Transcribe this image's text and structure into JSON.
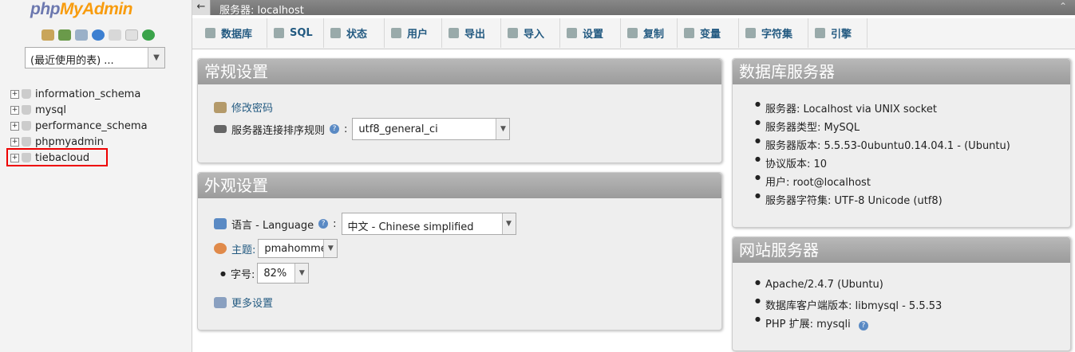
{
  "nav": {
    "logo_a": "php",
    "logo_b": "MyAdmin",
    "recent_value": "(最近使用的表) ...",
    "databases": [
      "information_schema",
      "mysql",
      "performance_schema",
      "phpmyadmin",
      "tiebacloud"
    ]
  },
  "serverbar": {
    "title": "服务器: localhost",
    "back": "←",
    "collapse": "⌃"
  },
  "tabs": [
    "数据库",
    "SQL",
    "状态",
    "用户",
    "导出",
    "导入",
    "设置",
    "复制",
    "变量",
    "字符集",
    "引擎"
  ],
  "general": {
    "title": "常规设置",
    "change_password": "修改密码",
    "collation_label": "服务器连接排序规则",
    "colon": ":",
    "collation_value": "utf8_general_ci"
  },
  "appearance": {
    "title": "外观设置",
    "language_label": "语言 - Language",
    "colon": ":",
    "language_value": "中文 - Chinese simplified",
    "theme_label": "主题:",
    "theme_value": "pmahomme",
    "font_label": "字号:",
    "font_value": "82%",
    "more": "更多设置"
  },
  "dbserver": {
    "title": "数据库服务器",
    "items": [
      "服务器: Localhost via UNIX socket",
      "服务器类型: MySQL",
      "服务器版本: 5.5.53-0ubuntu0.14.04.1 - (Ubuntu)",
      "协议版本: 10",
      "用户: root@localhost",
      "服务器字符集: UTF-8 Unicode (utf8)"
    ]
  },
  "webserver": {
    "title": "网站服务器",
    "items": [
      "Apache/2.4.7 (Ubuntu)",
      "数据库客户端版本: libmysql - 5.5.53",
      "PHP 扩展: mysqli"
    ]
  },
  "colors": {
    "link": "#235a81",
    "highlight": "#ee0000"
  }
}
